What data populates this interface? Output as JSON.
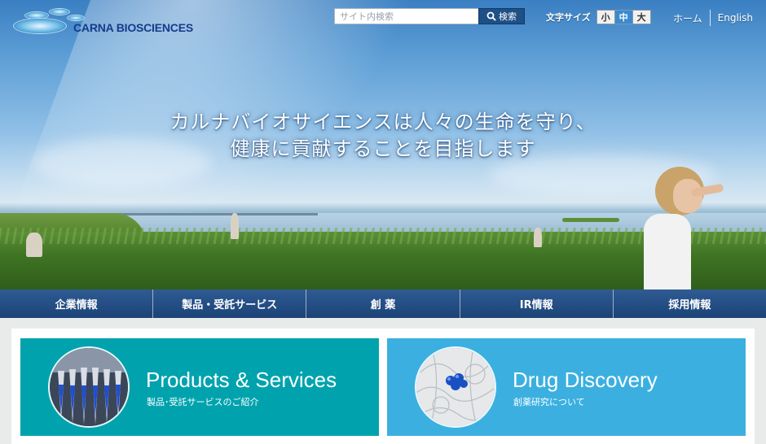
{
  "brand": {
    "name": "CARNA BIOSCIENCES"
  },
  "hero": {
    "tagline_line1": "カルナバイオサイエンスは人々の生命を守り、",
    "tagline_line2": "健康に貢献することを目指します"
  },
  "search": {
    "placeholder": "サイト内検索",
    "button_label": "検索"
  },
  "text_size": {
    "label": "文字サイズ",
    "options": [
      "小",
      "中",
      "大"
    ],
    "selected": "中"
  },
  "top_links": {
    "home": "ホーム",
    "english": "English"
  },
  "nav": {
    "items": [
      {
        "label": "企業情報"
      },
      {
        "label": "製品・受託サービス"
      },
      {
        "label": "創 薬"
      },
      {
        "label": "IR情報"
      },
      {
        "label": "採用情報"
      }
    ]
  },
  "cards": [
    {
      "title": "Products & Services",
      "subtitle": "製品･受託サービスのご紹介",
      "color": "#00a3ad"
    },
    {
      "title": "Drug Discovery",
      "subtitle": "創薬研究について",
      "color": "#3bb0e0"
    }
  ]
}
